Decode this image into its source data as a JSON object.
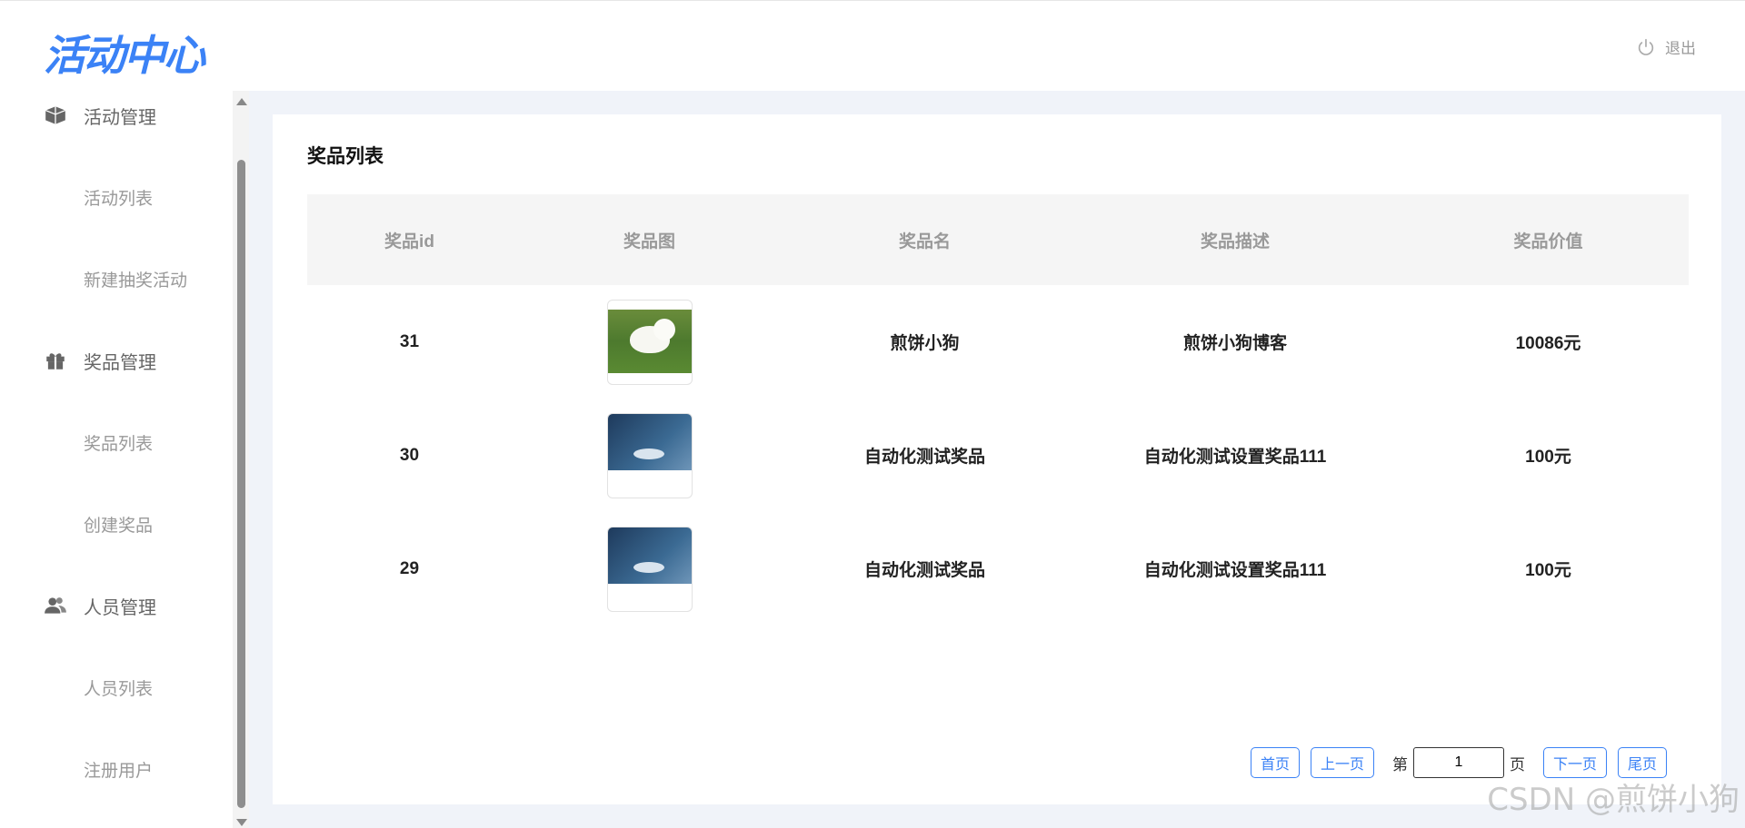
{
  "header": {
    "logo_text": "活动中心",
    "logout_label": "退出"
  },
  "sidebar": {
    "groups": [
      {
        "label": "活动管理",
        "icon": "box-icon",
        "items": [
          "活动列表",
          "新建抽奖活动"
        ]
      },
      {
        "label": "奖品管理",
        "icon": "gift-icon",
        "items": [
          "奖品列表",
          "创建奖品"
        ]
      },
      {
        "label": "人员管理",
        "icon": "users-icon",
        "items": [
          "人员列表",
          "注册用户"
        ]
      }
    ]
  },
  "main": {
    "title": "奖品列表",
    "table": {
      "headers": [
        "奖品id",
        "奖品图",
        "奖品名",
        "奖品描述",
        "奖品价值"
      ],
      "rows": [
        {
          "id": "31",
          "image": "dog-photo",
          "name": "煎饼小狗",
          "desc": "煎饼小狗博客",
          "value": "10086元"
        },
        {
          "id": "30",
          "image": "robot-vacuum-photo",
          "name": "自动化测试奖品",
          "desc": "自动化测试设置奖品111",
          "value": "100元"
        },
        {
          "id": "29",
          "image": "robot-vacuum-photo",
          "name": "自动化测试奖品",
          "desc": "自动化测试设置奖品111",
          "value": "100元"
        }
      ]
    },
    "pager": {
      "first": "首页",
      "prev": "上一页",
      "page_prefix": "第",
      "page_value": "1",
      "page_suffix": "页",
      "next": "下一页",
      "last": "尾页"
    }
  },
  "watermark": "CSDN @煎饼小狗",
  "colors": {
    "accent": "#3b82f6",
    "bg": "#f0f3f9"
  }
}
